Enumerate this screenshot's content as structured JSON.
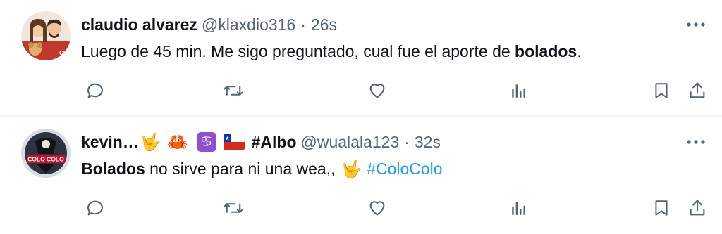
{
  "tweets": [
    {
      "display_name": "claudio alvarez",
      "handle": "@klaxdio316",
      "separator": "·",
      "time": "26s",
      "text_before": "Luego de 45 min. Me sigo preguntado, cual fue el aporte de ",
      "text_bold": "bolados",
      "text_after": ".",
      "avatar_icon": "couple-with-dog-avatar"
    },
    {
      "display_name": "kevin…",
      "display_name_suffix": "#Albo",
      "name_emojis": [
        "rock-on-hand-emoji",
        "crab-emoji",
        "cancer-zodiac-emoji",
        "chile-flag-emoji"
      ],
      "emoji_glyphs": [
        "🤟",
        "🦀",
        "♋",
        "🇨🇱"
      ],
      "handle": "@wualala123",
      "separator": "·",
      "time": "32s",
      "text_bold": "Bolados",
      "text_after": " no sirve para ni una wea,, ",
      "text_emoji": "🤟",
      "hashtag": "#ColoColo",
      "avatar_icon": "colo-colo-crest-avatar",
      "avatar_text": "COLO COLO"
    }
  ],
  "colors": {
    "text": "#0f1419",
    "secondary": "#536471",
    "link": "#1d9bf0",
    "divider": "#eff3f4"
  },
  "actions": [
    "reply-icon",
    "retweet-icon",
    "like-icon",
    "views-icon",
    "bookmark-icon",
    "share-icon"
  ]
}
